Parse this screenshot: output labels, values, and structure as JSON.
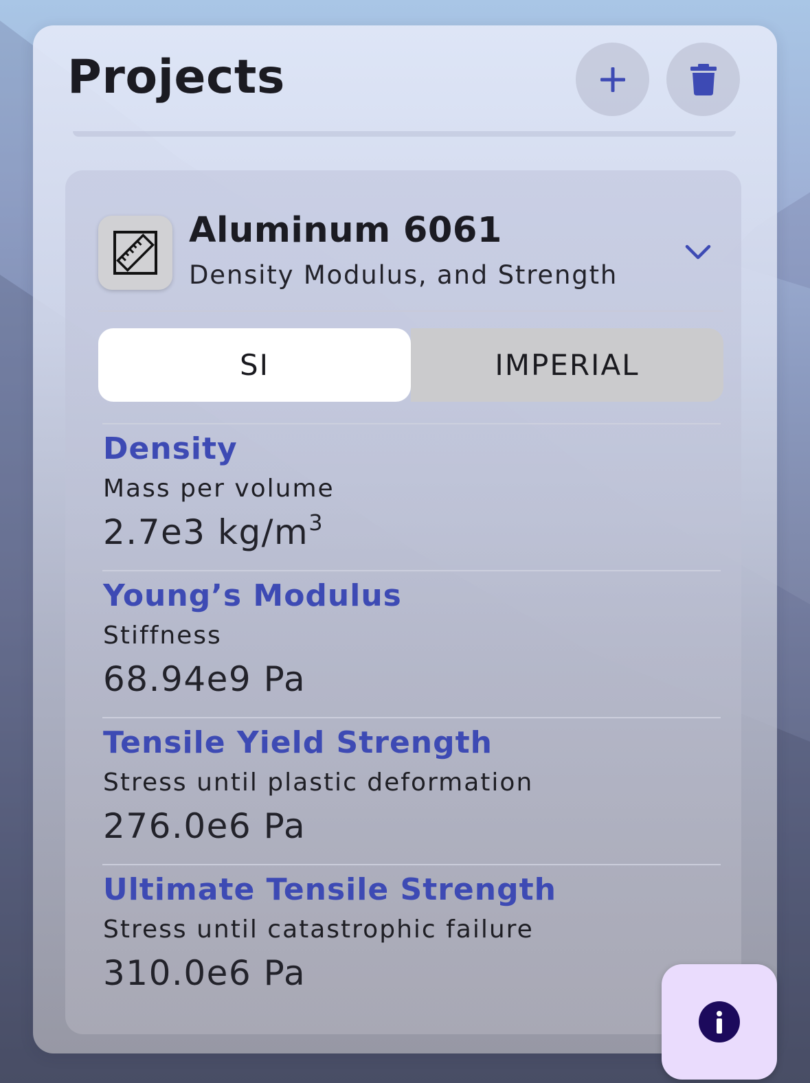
{
  "header": {
    "title": "Projects",
    "add_icon": "plus-icon",
    "delete_icon": "trash-icon"
  },
  "material": {
    "icon": "ruler-icon",
    "name": "Aluminum 6061",
    "subtitle": "Density Modulus, and Strength",
    "expand_icon": "chevron-down-icon"
  },
  "units": {
    "options": [
      "SI",
      "IMPERIAL"
    ],
    "selected": "SI"
  },
  "properties": [
    {
      "name": "Density",
      "description": "Mass per volume",
      "value": "2.7e3 kg/m",
      "superscript": "3"
    },
    {
      "name": "Young’s Modulus",
      "description": "Stiffness",
      "value": "68.94e9 Pa"
    },
    {
      "name": "Tensile Yield Strength",
      "description": "Stress until plastic deformation",
      "value": "276.0e6 Pa"
    },
    {
      "name": "Ultimate Tensile Strength",
      "description": "Stress until catastrophic failure",
      "value": "310.0e6 Pa"
    }
  ],
  "fab": {
    "icon": "info-icon"
  },
  "colors": {
    "accent": "#3d4ab4",
    "fab_background": "#eadcfd",
    "fab_icon": "#1c0a5c"
  }
}
